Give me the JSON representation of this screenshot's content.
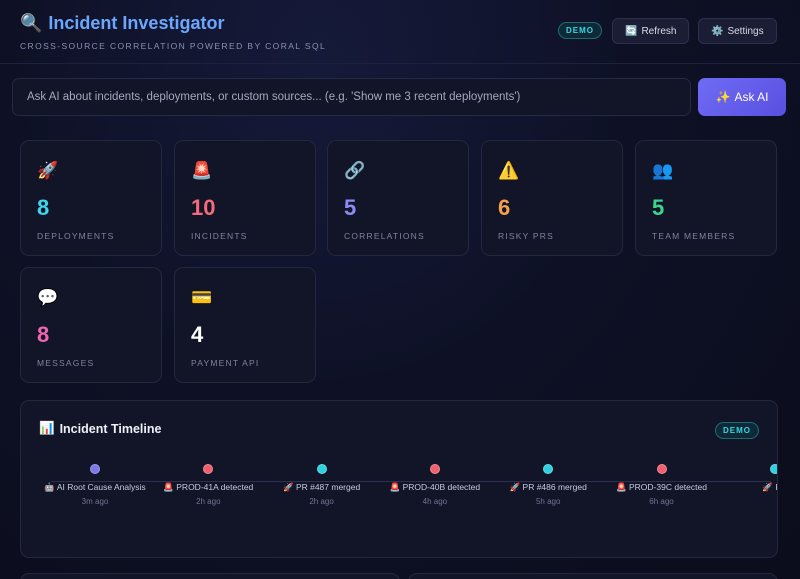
{
  "header": {
    "title": "Incident Investigator",
    "subtitle": "CROSS-SOURCE CORRELATION POWERED BY CORAL SQL",
    "badge": "DEMO",
    "refresh_label": "Refresh",
    "settings_label": "Settings",
    "title_icon": "search-icon",
    "refresh_icon": "refresh-icon",
    "settings_icon": "gear-icon"
  },
  "ask": {
    "placeholder": "Ask AI about incidents, deployments, or custom sources... (e.g. 'Show me 3 recent deployments')",
    "button_label": "Ask AI",
    "button_icon": "sparkles-icon"
  },
  "stats": [
    {
      "icon": "🚀",
      "icon_name": "rocket-icon",
      "value": "8",
      "label": "DEPLOYMENTS",
      "color": "#3ad7ef"
    },
    {
      "icon": "🚨",
      "icon_name": "siren-icon",
      "value": "10",
      "label": "INCIDENTS",
      "color": "#f56b7a"
    },
    {
      "icon": "🔗",
      "icon_name": "link-icon",
      "value": "5",
      "label": "CORRELATIONS",
      "color": "#8b8cf7"
    },
    {
      "icon": "⚠️",
      "icon_name": "warning-icon",
      "value": "6",
      "label": "RISKY PRS",
      "color": "#f6a04d"
    },
    {
      "icon": "👥",
      "icon_name": "team-icon",
      "value": "5",
      "label": "TEAM MEMBERS",
      "color": "#3ad58f"
    },
    {
      "icon": "💬",
      "icon_name": "chat-icon",
      "value": "8",
      "label": "MESSAGES",
      "color": "#f064b0"
    },
    {
      "icon": "💳",
      "icon_name": "credit-card-icon",
      "value": "4",
      "label": "PAYMENT API",
      "color": "#ffffff"
    }
  ],
  "timeline": {
    "title": "Incident Timeline",
    "title_icon": "bar-chart-icon",
    "badge": "DEMO",
    "events": [
      {
        "icon": "🤖",
        "title": "AI Root Cause Analysis",
        "time": "3m ago",
        "color": "#7c78e8"
      },
      {
        "icon": "🚨",
        "title": "PROD-41A detected",
        "time": "2h ago",
        "color": "#f0606e"
      },
      {
        "icon": "🚀",
        "title": "PR #487 merged",
        "time": "2h ago",
        "color": "#2fd0e0"
      },
      {
        "icon": "🚨",
        "title": "PROD-40B detected",
        "time": "4h ago",
        "color": "#f0606e"
      },
      {
        "icon": "🚀",
        "title": "PR #486 merged",
        "time": "5h ago",
        "color": "#2fd0e0"
      },
      {
        "icon": "🚨",
        "title": "PROD-39C detected",
        "time": "6h ago",
        "color": "#f0606e"
      },
      {
        "icon": "🚀",
        "title": "PR",
        "time": "",
        "color": "#2fd0e0"
      }
    ]
  }
}
